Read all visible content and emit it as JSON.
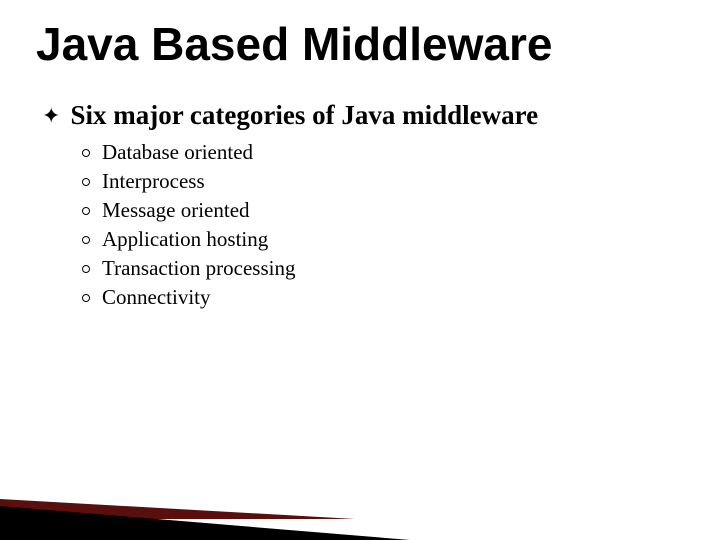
{
  "title": "Java Based Middleware",
  "main_bullet_icon": "✦",
  "main_bullet_text": "Six major categories of Java middleware",
  "subitems": [
    "Database oriented",
    "Interprocess",
    "Message oriented",
    "Application hosting",
    "Transaction processing",
    "Connectivity"
  ],
  "colors": {
    "accent_dark": "#5a0f0f",
    "black": "#000000"
  }
}
